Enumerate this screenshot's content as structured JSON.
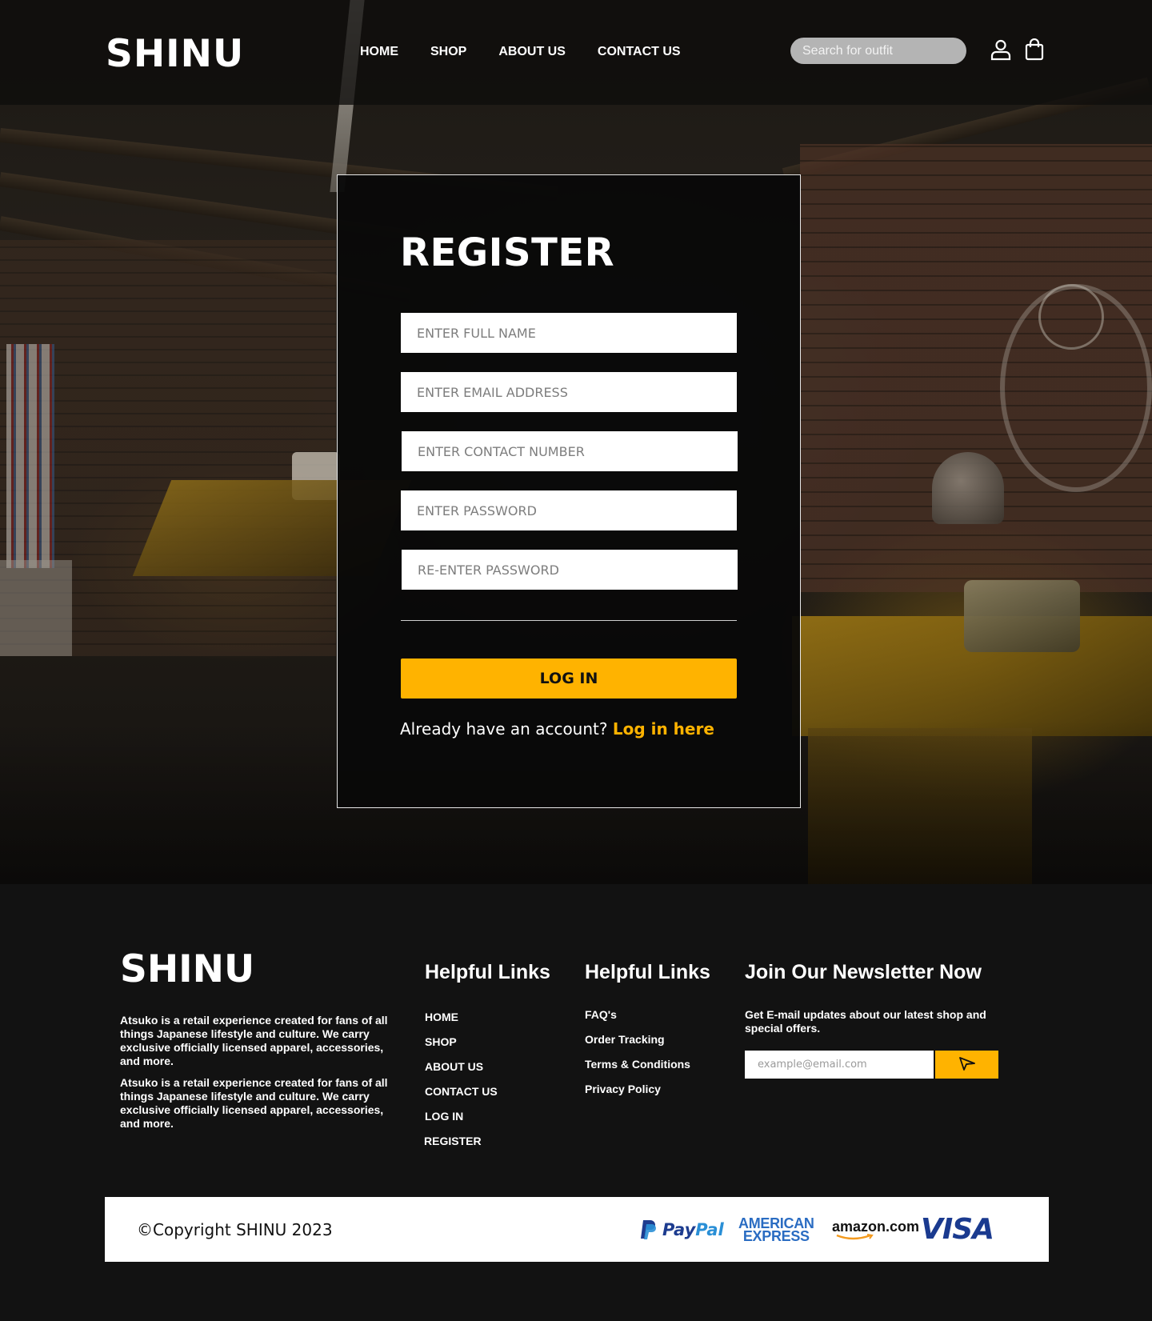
{
  "header": {
    "logo": "SHINU",
    "nav": [
      "HOME",
      "SHOP",
      "ABOUT US",
      "CONTACT US"
    ],
    "search_placeholder": "Search for outfit",
    "icons": [
      "user-icon",
      "shopping-bag-icon"
    ]
  },
  "register": {
    "title": "REGISTER",
    "fields": [
      "ENTER FULL NAME",
      "ENTER EMAIL ADDRESS",
      "ENTER CONTACT NUMBER",
      "ENTER PASSWORD",
      "RE-ENTER PASSWORD"
    ],
    "submit_label": "LOG IN",
    "already_text": "Already have an account?",
    "login_link": "Log in here"
  },
  "footer": {
    "logo": "SHINU",
    "about": [
      "Atsuko is a retail experience created for fans of all things Japanese lifestyle and culture. We carry exclusive officially licensed apparel, accessories, and more.",
      "Atsuko is a retail experience created for fans of all things Japanese lifestyle and culture. We carry exclusive officially licensed apparel, accessories, and more."
    ],
    "links_col1": {
      "heading": "Helpful Links",
      "items": [
        "HOME",
        "SHOP",
        "ABOUT US",
        "CONTACT US",
        "LOG IN",
        "REGISTER"
      ]
    },
    "links_col2": {
      "heading": "Helpful Links",
      "items": [
        "FAQ's",
        "Order Tracking",
        "Terms & Conditions",
        "Privacy Policy"
      ]
    },
    "newsletter": {
      "heading": "Join Our Newsletter Now",
      "text": "Get E-mail updates about our latest shop and special offers.",
      "email_placeholder": "example@email.com",
      "send_icon": "send-arrow-icon"
    },
    "copyright": "©Copyright SHINU 2023",
    "payments": {
      "paypal_a": "Pay",
      "paypal_b": "Pal",
      "amex_line1": "AMERICAN",
      "amex_line2": "EXPRESS",
      "amazon": "amazon.com",
      "visa": "VISA"
    }
  },
  "colors": {
    "accent": "#ffb300",
    "footer_bg": "#121212",
    "card_bg": "#080808"
  }
}
